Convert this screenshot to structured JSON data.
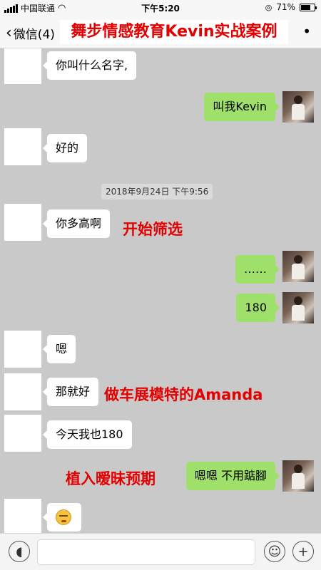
{
  "status_bar": {
    "carrier": "中国联通",
    "time": "下午5:20",
    "battery": "71%",
    "battery_level": 0.71
  },
  "nav": {
    "back_label": "微信(4)",
    "more": "•",
    "banner": "舞步情感教育Kevin实战案例"
  },
  "chat": {
    "messages": [
      {
        "side": "in",
        "text": "你叫什么名字,"
      },
      {
        "side": "out",
        "text": "叫我Kevin"
      },
      {
        "side": "in",
        "text": "好的"
      },
      {
        "side": "in",
        "text": "你多高啊"
      },
      {
        "side": "out",
        "text": "……"
      },
      {
        "side": "out",
        "text": "180"
      },
      {
        "side": "in",
        "text": "嗯"
      },
      {
        "side": "in",
        "text": "那就好"
      },
      {
        "side": "in",
        "text": "今天我也180"
      },
      {
        "side": "out",
        "text": "嗯嗯 不用踮腳"
      },
      {
        "side": "in",
        "emoji": "grimace-emoji"
      }
    ],
    "timestamp": "2018年9月24日 下午9:56",
    "notes": [
      "开始筛选",
      "做车展模特的Amanda",
      "植入暧昧预期"
    ]
  },
  "input_bar": {
    "voice_icon": "voice-icon",
    "emoji_icon": "emoji-icon",
    "plus_icon": "plus-icon",
    "input_value": ""
  }
}
